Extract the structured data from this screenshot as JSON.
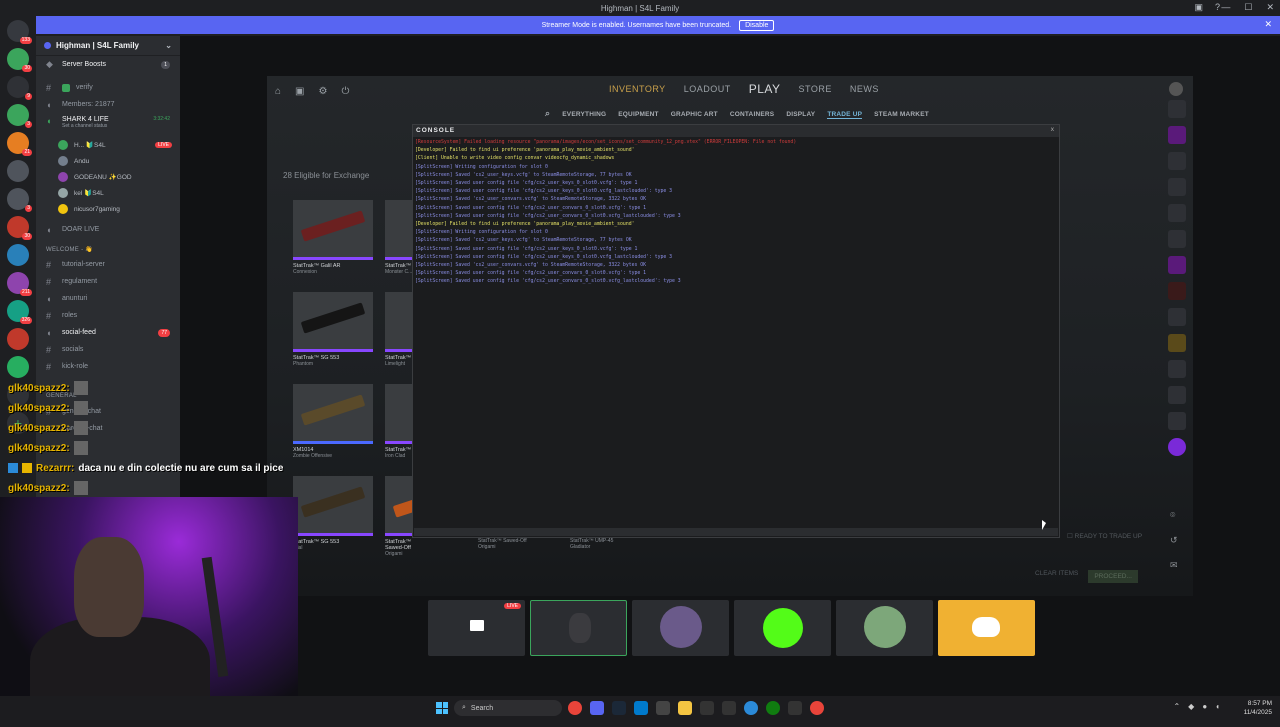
{
  "window": {
    "title": "Highman | S4L Family",
    "streamer_text": "Streamer Mode is enabled. Usernames have been truncated.",
    "disable_label": "Disable",
    "tb_icons": [
      "inbox-icon",
      "help-icon"
    ],
    "ctrls": [
      "—",
      "☐",
      "✕"
    ]
  },
  "sidebar": {
    "server_name": "Highman | S4L Family",
    "boosts": {
      "label": "Server Boosts",
      "count": "1"
    },
    "channels": [
      {
        "label": "verify",
        "type": "text"
      },
      {
        "label": "Members: 21877",
        "type": "voice"
      },
      {
        "label": "SHARK 4 LIFE",
        "sub": "Set a channel status",
        "time": "3:32:42",
        "type": "voice-active"
      }
    ],
    "voice_users": [
      {
        "name": "H... 🔰S4L",
        "live": "LIVE"
      },
      {
        "name": "Andu",
        "live": ""
      },
      {
        "name": "GODEANU ✨GOD",
        "live": ""
      },
      {
        "name": "kel 🔰S4L",
        "live": ""
      },
      {
        "name": "nicusor7gaming",
        "live": ""
      }
    ],
    "doar_live": "DOAR LIVE",
    "welcome_cat": "WELCOME - 👋",
    "welcome_channels": [
      {
        "label": "tutorial-server"
      },
      {
        "label": "regulament"
      },
      {
        "label": "anunturi"
      },
      {
        "label": "roles"
      },
      {
        "label": "social-feed",
        "count": "77"
      },
      {
        "label": "socials"
      },
      {
        "label": "kick-role"
      }
    ],
    "general_cat": "GENERAL",
    "general_channels": [
      {
        "label": "general-chat"
      },
      {
        "label": "warcraft-chat"
      }
    ]
  },
  "chat": [
    {
      "user": "glk40spazz2:",
      "msg": ""
    },
    {
      "user": "glk40spazz2:",
      "msg": ""
    },
    {
      "user": "glk40spazz2:",
      "msg": ""
    },
    {
      "user": "glk40spazz2:",
      "msg": ""
    },
    {
      "user": "Rezarrr:",
      "msg": "daca nu e din colectie nu are cum sa il pice"
    },
    {
      "user": "glk40spazz2:",
      "msg": ""
    }
  ],
  "game": {
    "tabs": [
      "INVENTORY",
      "LOADOUT",
      "PLAY",
      "STORE",
      "NEWS"
    ],
    "subnav": [
      "EVERYTHING",
      "EQUIPMENT",
      "GRAPHIC ART",
      "CONTAINERS",
      "DISPLAY",
      "TRADE UP",
      "STEAM MARKET"
    ],
    "eligible": "28 Eligible for Exchange",
    "weapons": [
      {
        "name": "StatTrak™ Galil AR",
        "sub": "Connexion"
      },
      {
        "name": "StatTrak™",
        "sub": "Monster C..."
      },
      {
        "name": "StatTrak™ SG 553",
        "sub": "Phantom"
      },
      {
        "name": "StatTrak™",
        "sub": "Limelight"
      },
      {
        "name": "XM1014",
        "sub": "Zombie Offensive"
      },
      {
        "name": "StatTrak™",
        "sub": "Iron Clad"
      },
      {
        "name": "StatTrak™ SG 553",
        "sub": "erial"
      },
      {
        "name": "StatTrak™ Sawed-Off",
        "sub": "Origami"
      }
    ],
    "bottom_labels": [
      "StatTrak™ Sawed-Off",
      "StatTrak™ UMP-45"
    ],
    "bottom_subs": [
      "Origami",
      "Gladiator"
    ],
    "ready": "READY TO TRADE UP",
    "clear": "CLEAR ITEMS",
    "proceed": "PROCEED..."
  },
  "console": {
    "title": "CONSOLE",
    "close": "x",
    "lines": [
      {
        "c": "red",
        "t": "[ResourceSystem] Failed loading resource \"panorama/images/econ/set_icons/set_community_12_png.vtex\" (ERROR_FILEOPEN: File not found)"
      },
      {
        "c": "yellow",
        "t": "[Developer] Failed to find ui preference 'panorama_play_movie_ambient_sound'"
      },
      {
        "c": "yellow",
        "t": "[Client] Unable to write video config convar videocfg_dynamic_shadows"
      },
      {
        "c": "blue",
        "t": "[SplitScreen] Writing configuration for slot 0"
      },
      {
        "c": "blue",
        "t": "[SplitScreen] Saved 'cs2_user_keys.vcfg' to SteamRemoteStorage, 77 bytes OK"
      },
      {
        "c": "blue",
        "t": "[SplitScreen] Saved user config file 'cfg/cs2_user_keys_0_slot0.vcfg': type 1"
      },
      {
        "c": "blue",
        "t": "[SplitScreen] Saved user config file 'cfg/cs2_user_keys_0_slot0.vcfg_lastclouded': type 3"
      },
      {
        "c": "blue",
        "t": "[SplitScreen] Saved 'cs2_user_convars.vcfg' to SteamRemoteStorage, 3322 bytes OK"
      },
      {
        "c": "blue",
        "t": "[SplitScreen] Saved user config file 'cfg/cs2_user_convars_0_slot0.vcfg': type 1"
      },
      {
        "c": "blue",
        "t": "[SplitScreen] Saved user config file 'cfg/cs2_user_convars_0_slot0.vcfg_lastclouded': type 3"
      },
      {
        "c": "yellow",
        "t": "[Developer] Failed to find ui preference 'panorama_play_movie_ambient_sound'"
      },
      {
        "c": "blue",
        "t": "[SplitScreen] Writing configuration for slot 0"
      },
      {
        "c": "blue",
        "t": "[SplitScreen] Saved 'cs2_user_keys.vcfg' to SteamRemoteStorage, 77 bytes OK"
      },
      {
        "c": "blue",
        "t": "[SplitScreen] Saved user config file 'cfg/cs2_user_keys_0_slot0.vcfg': type 1"
      },
      {
        "c": "blue",
        "t": "[SplitScreen] Saved user config file 'cfg/cs2_user_keys_0_slot0.vcfg_lastclouded': type 3"
      },
      {
        "c": "blue",
        "t": "[SplitScreen] Saved 'cs2_user_convars.vcfg' to SteamRemoteStorage, 3322 bytes OK"
      },
      {
        "c": "blue",
        "t": "[SplitScreen] Saved user config file 'cfg/cs2_user_convars_0_slot0.vcfg': type 1"
      },
      {
        "c": "blue",
        "t": "[SplitScreen] Saved user config file 'cfg/cs2_user_convars_0_slot0.vcfg_lastclouded': type 3"
      }
    ]
  },
  "stream_tiles": [
    {
      "kind": "screen",
      "live": "LIVE"
    },
    {
      "kind": "cam",
      "live": ""
    },
    {
      "kind": "av1",
      "live": ""
    },
    {
      "kind": "kick",
      "live": ""
    },
    {
      "kind": "av2",
      "live": ""
    },
    {
      "kind": "discord",
      "live": ""
    }
  ],
  "taskbar": {
    "search": "Search",
    "time": "8:57 PM",
    "date": "11/4/2025"
  },
  "colors": {
    "accent": "#5865f2",
    "live": "#f23f43",
    "kick": "#53fc18",
    "discord_tile": "#f0b132"
  }
}
